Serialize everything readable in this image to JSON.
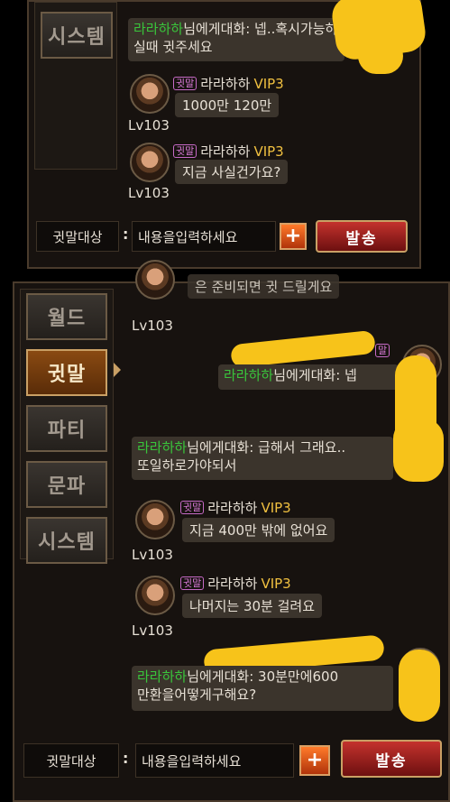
{
  "colors": {
    "sender_green": "#39c53b",
    "vip_gold": "#f0c040",
    "whisper_pink": "#d97ad8",
    "active_tab": "#8a4a12",
    "send_red": "#c4322d",
    "scribble_yellow": "#f7c31a"
  },
  "top": {
    "tab_system": "시스템",
    "messages": [
      {
        "sender": "라라하하",
        "text": "님에게대화: 넵..혹시가능하",
        "text2": "실때 귓주세요"
      }
    ],
    "whispers": [
      {
        "badge": "귓말",
        "name": "라라하하",
        "vip": "VIP3",
        "message": "1000만 120만",
        "level": "Lv103"
      },
      {
        "badge": "귓말",
        "name": "라라하하",
        "vip": "VIP3",
        "message": "지금 사실건가요?",
        "level": "Lv103"
      }
    ],
    "input": {
      "label": "귓말대상",
      "colon": ":",
      "placeholder": "내용을입력하세요",
      "plus": "+",
      "send": "발송"
    }
  },
  "bottom": {
    "tabs": [
      "월드",
      "귓말",
      "파티",
      "문파",
      "시스템"
    ],
    "active_tab": "귓말",
    "partial_text": "은 준비되면 귓 드릴게요",
    "partial_level": "Lv103",
    "letter_l": "L",
    "badge_edge": "말",
    "msg_reply": {
      "sender": "라라하하",
      "text": "님에게대화: 넵"
    },
    "msg_hurry": {
      "sender": "라라하하",
      "text": "님에게대화: 급해서 그래요..",
      "text2": "또일하로가야되서"
    },
    "whispers": [
      {
        "badge": "귓말",
        "name": "라라하하",
        "vip": "VIP3",
        "message": "지금 400만 밖에 없어요",
        "level": "Lv103"
      },
      {
        "badge": "귓말",
        "name": "라라하하",
        "vip": "VIP3",
        "message": "나머지는 30분 걸려요",
        "level": "Lv103"
      }
    ],
    "msg_final": {
      "sender": "라라하하",
      "text": "님에게대화: 30분만에600",
      "text2": "만환을어떻게구해요?"
    },
    "input": {
      "label": "귓말대상",
      "colon": ":",
      "placeholder": "내용을입력하세요",
      "plus": "+",
      "send": "발송"
    }
  }
}
